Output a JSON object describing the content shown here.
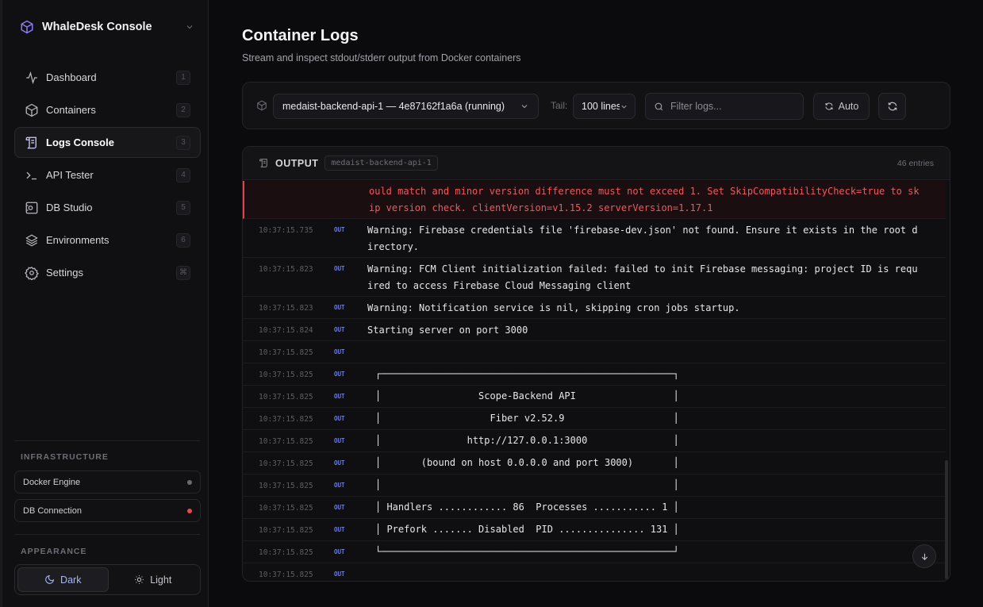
{
  "app": {
    "name": "WhaleDesk Console"
  },
  "sidebar": {
    "items": [
      {
        "label": "Dashboard",
        "key": "1",
        "icon": "activity-icon"
      },
      {
        "label": "Containers",
        "key": "2",
        "icon": "box-icon"
      },
      {
        "label": "Logs Console",
        "key": "3",
        "icon": "scroll-icon",
        "active": true
      },
      {
        "label": "API Tester",
        "key": "4",
        "icon": "terminal-icon"
      },
      {
        "label": "DB Studio",
        "key": "5",
        "icon": "database-icon"
      },
      {
        "label": "Environments",
        "key": "6",
        "icon": "layers-icon"
      },
      {
        "label": "Settings",
        "key": "⌘",
        "icon": "gear-icon"
      }
    ],
    "infrastructure_title": "INFRASTRUCTURE",
    "infrastructure": [
      {
        "label": "Docker Engine",
        "status_color": "#6b6b72"
      },
      {
        "label": "DB Connection",
        "status_color": "#e5484d"
      }
    ],
    "appearance_title": "APPEARANCE",
    "theme": {
      "dark": "Dark",
      "light": "Light",
      "selected": "Dark"
    }
  },
  "header": {
    "title": "Container Logs",
    "subtitle": "Stream and inspect stdout/stderr output from Docker containers"
  },
  "toolbar": {
    "container_select": "medaist-backend-api-1 — 4e87162f1a6a (running)",
    "tail_label": "Tail:",
    "tail_select": "100 lines",
    "filter_placeholder": "Filter logs...",
    "auto_label": "Auto"
  },
  "output": {
    "title": "OUTPUT",
    "container_tag": "medaist-backend-api-1",
    "count": "46 entries",
    "rows": [
      {
        "ts": "",
        "stream": "",
        "lines": [
          "ould match and minor version difference must not exceed 1. Set SkipCompatibilityCheck=true to sk",
          "ip version check. clientVersion=v1.15.2 serverVersion=1.17.1"
        ],
        "error": true
      },
      {
        "ts": "10:37:15.735",
        "stream": "OUT",
        "lines": [
          "Warning: Firebase credentials file 'firebase-dev.json' not found. Ensure it exists in the root d",
          "irectory."
        ]
      },
      {
        "ts": "10:37:15.823",
        "stream": "OUT",
        "lines": [
          "Warning: FCM Client initialization failed: failed to init Firebase messaging: project ID is requ",
          "ired to access Firebase Cloud Messaging client"
        ]
      },
      {
        "ts": "10:37:15.823",
        "stream": "OUT",
        "lines": [
          "Warning: Notification service is nil, skipping cron jobs startup."
        ]
      },
      {
        "ts": "10:37:15.824",
        "stream": "OUT",
        "lines": [
          "Starting server on port 3000"
        ]
      },
      {
        "ts": "10:37:15.825",
        "stream": "OUT",
        "lines": [
          ""
        ]
      },
      {
        "ts": "10:37:15.825",
        "stream": "OUT",
        "lines": [
          "┌───────────────────────────────────────────────────┐"
        ],
        "box": true
      },
      {
        "ts": "10:37:15.825",
        "stream": "OUT",
        "lines": [
          "│                 Scope-Backend API                 │"
        ],
        "box": true
      },
      {
        "ts": "10:37:15.825",
        "stream": "OUT",
        "lines": [
          "│                   Fiber v2.52.9                   │"
        ],
        "box": true
      },
      {
        "ts": "10:37:15.825",
        "stream": "OUT",
        "lines": [
          "│               http://127.0.0.1:3000               │"
        ],
        "box": true
      },
      {
        "ts": "10:37:15.825",
        "stream": "OUT",
        "lines": [
          "│       (bound on host 0.0.0.0 and port 3000)       │"
        ],
        "box": true
      },
      {
        "ts": "10:37:15.825",
        "stream": "OUT",
        "lines": [
          "│                                                   │"
        ],
        "box": true
      },
      {
        "ts": "10:37:15.825",
        "stream": "OUT",
        "lines": [
          "│ Handlers ............ 86  Processes ........... 1 │"
        ],
        "box": true
      },
      {
        "ts": "10:37:15.825",
        "stream": "OUT",
        "lines": [
          "│ Prefork ....... Disabled  PID ............... 131 │"
        ],
        "box": true
      },
      {
        "ts": "10:37:15.825",
        "stream": "OUT",
        "lines": [
          "└───────────────────────────────────────────────────┘"
        ],
        "box": true
      },
      {
        "ts": "10:37:15.825",
        "stream": "OUT",
        "lines": [
          ""
        ]
      }
    ]
  },
  "colors": {
    "accent": "#6d7bd6",
    "error": "#f0585f",
    "bg": "#0b0b0d"
  }
}
